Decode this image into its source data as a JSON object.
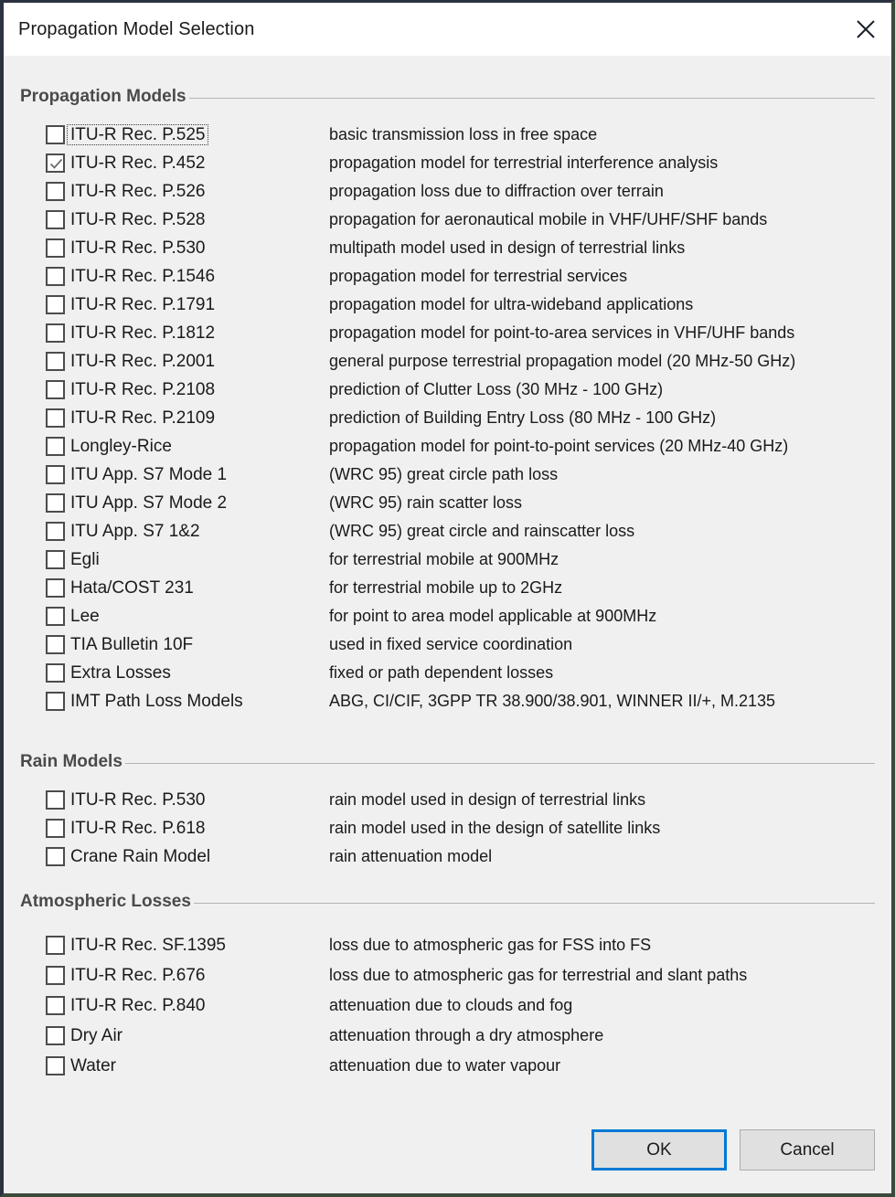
{
  "window": {
    "title": "Propagation Model Selection",
    "close_icon": "close-icon",
    "accent_color": "#0078d4",
    "background_color": "#f0f0f0",
    "titlebar_color": "#ffffff"
  },
  "sections": [
    {
      "id": "propagation",
      "header": "Propagation Models",
      "items": [
        {
          "label": "ITU-R Rec. P.525",
          "desc": "basic transmission loss in free space",
          "checked": false,
          "focused": true
        },
        {
          "label": "ITU-R Rec. P.452",
          "desc": "propagation model for terrestrial interference analysis",
          "checked": true,
          "focused": false
        },
        {
          "label": "ITU-R Rec. P.526",
          "desc": "propagation loss due to diffraction over terrain",
          "checked": false,
          "focused": false
        },
        {
          "label": "ITU-R Rec. P.528",
          "desc": " propagation for aeronautical mobile in VHF/UHF/SHF bands",
          "checked": false,
          "focused": false
        },
        {
          "label": "ITU-R Rec. P.530",
          "desc": "multipath model used in design of terrestrial links",
          "checked": false,
          "focused": false
        },
        {
          "label": "ITU-R Rec. P.1546",
          "desc": "propagation model for terrestrial services",
          "checked": false,
          "focused": false
        },
        {
          "label": "ITU-R Rec. P.1791",
          "desc": "propagation model for ultra-wideband applications",
          "checked": false,
          "focused": false
        },
        {
          "label": "ITU-R Rec. P.1812",
          "desc": "propagation model for point-to-area services in VHF/UHF bands",
          "checked": false,
          "focused": false
        },
        {
          "label": "ITU-R Rec. P.2001",
          "desc": "general purpose terrestrial propagation model (20 MHz-50 GHz)",
          "checked": false,
          "focused": false
        },
        {
          "label": "ITU-R Rec. P.2108",
          "desc": "prediction of Clutter Loss (30 MHz - 100 GHz)",
          "checked": false,
          "focused": false
        },
        {
          "label": "ITU-R Rec. P.2109",
          "desc": "prediction of Building Entry Loss (80 MHz - 100 GHz)",
          "checked": false,
          "focused": false
        },
        {
          "label": "Longley-Rice",
          "desc": "propagation model for point-to-point services (20 MHz-40 GHz)",
          "checked": false,
          "focused": false
        },
        {
          "label": "ITU App. S7 Mode 1",
          "desc": "(WRC 95) great circle path loss",
          "checked": false,
          "focused": false
        },
        {
          "label": "ITU App. S7 Mode 2",
          "desc": "(WRC 95) rain scatter loss",
          "checked": false,
          "focused": false
        },
        {
          "label": "ITU App. S7 1&2",
          "desc": "(WRC 95) great circle and rainscatter loss",
          "checked": false,
          "focused": false
        },
        {
          "label": "Egli",
          "desc": "for terrestrial mobile at 900MHz",
          "checked": false,
          "focused": false
        },
        {
          "label": "Hata/COST 231",
          "desc": "for terrestrial mobile up to 2GHz",
          "checked": false,
          "focused": false
        },
        {
          "label": "Lee",
          "desc": "for point to area model applicable at 900MHz",
          "checked": false,
          "focused": false
        },
        {
          "label": "TIA Bulletin 10F",
          "desc": "used in fixed service coordination",
          "checked": false,
          "focused": false
        },
        {
          "label": "Extra Losses",
          "desc": "fixed or path dependent losses",
          "checked": false,
          "focused": false
        },
        {
          "label": "IMT Path Loss Models",
          "desc": "ABG, CI/CIF, 3GPP TR 38.900/38.901, WINNER II/+, M.2135",
          "checked": false,
          "focused": false
        }
      ]
    },
    {
      "id": "rain",
      "header": "Rain Models",
      "items": [
        {
          "label": "ITU-R Rec. P.530",
          "desc": "rain model used in design of terrestrial links",
          "checked": false,
          "focused": false
        },
        {
          "label": "ITU-R Rec. P.618",
          "desc": "rain model used in the design of satellite links",
          "checked": false,
          "focused": false
        },
        {
          "label": "Crane Rain Model",
          "desc": "rain attenuation model",
          "checked": false,
          "focused": false
        }
      ]
    },
    {
      "id": "atmos",
      "header": "Atmospheric Losses",
      "items": [
        {
          "label": "ITU-R Rec. SF.1395",
          "desc": "loss due to atmospheric gas for FSS into FS",
          "checked": false,
          "focused": false
        },
        {
          "label": "ITU-R Rec. P.676",
          "desc": "loss due to atmospheric gas for terrestrial and slant paths",
          "checked": false,
          "focused": false
        },
        {
          "label": "ITU-R Rec. P.840",
          "desc": "attenuation due to clouds and fog",
          "checked": false,
          "focused": false
        },
        {
          "label": "Dry Air",
          "desc": "attenuation through a dry atmosphere",
          "checked": false,
          "focused": false
        },
        {
          "label": "Water",
          "desc": "attenuation due to water vapour",
          "checked": false,
          "focused": false
        }
      ]
    }
  ],
  "footer": {
    "ok_label": "OK",
    "cancel_label": "Cancel"
  }
}
